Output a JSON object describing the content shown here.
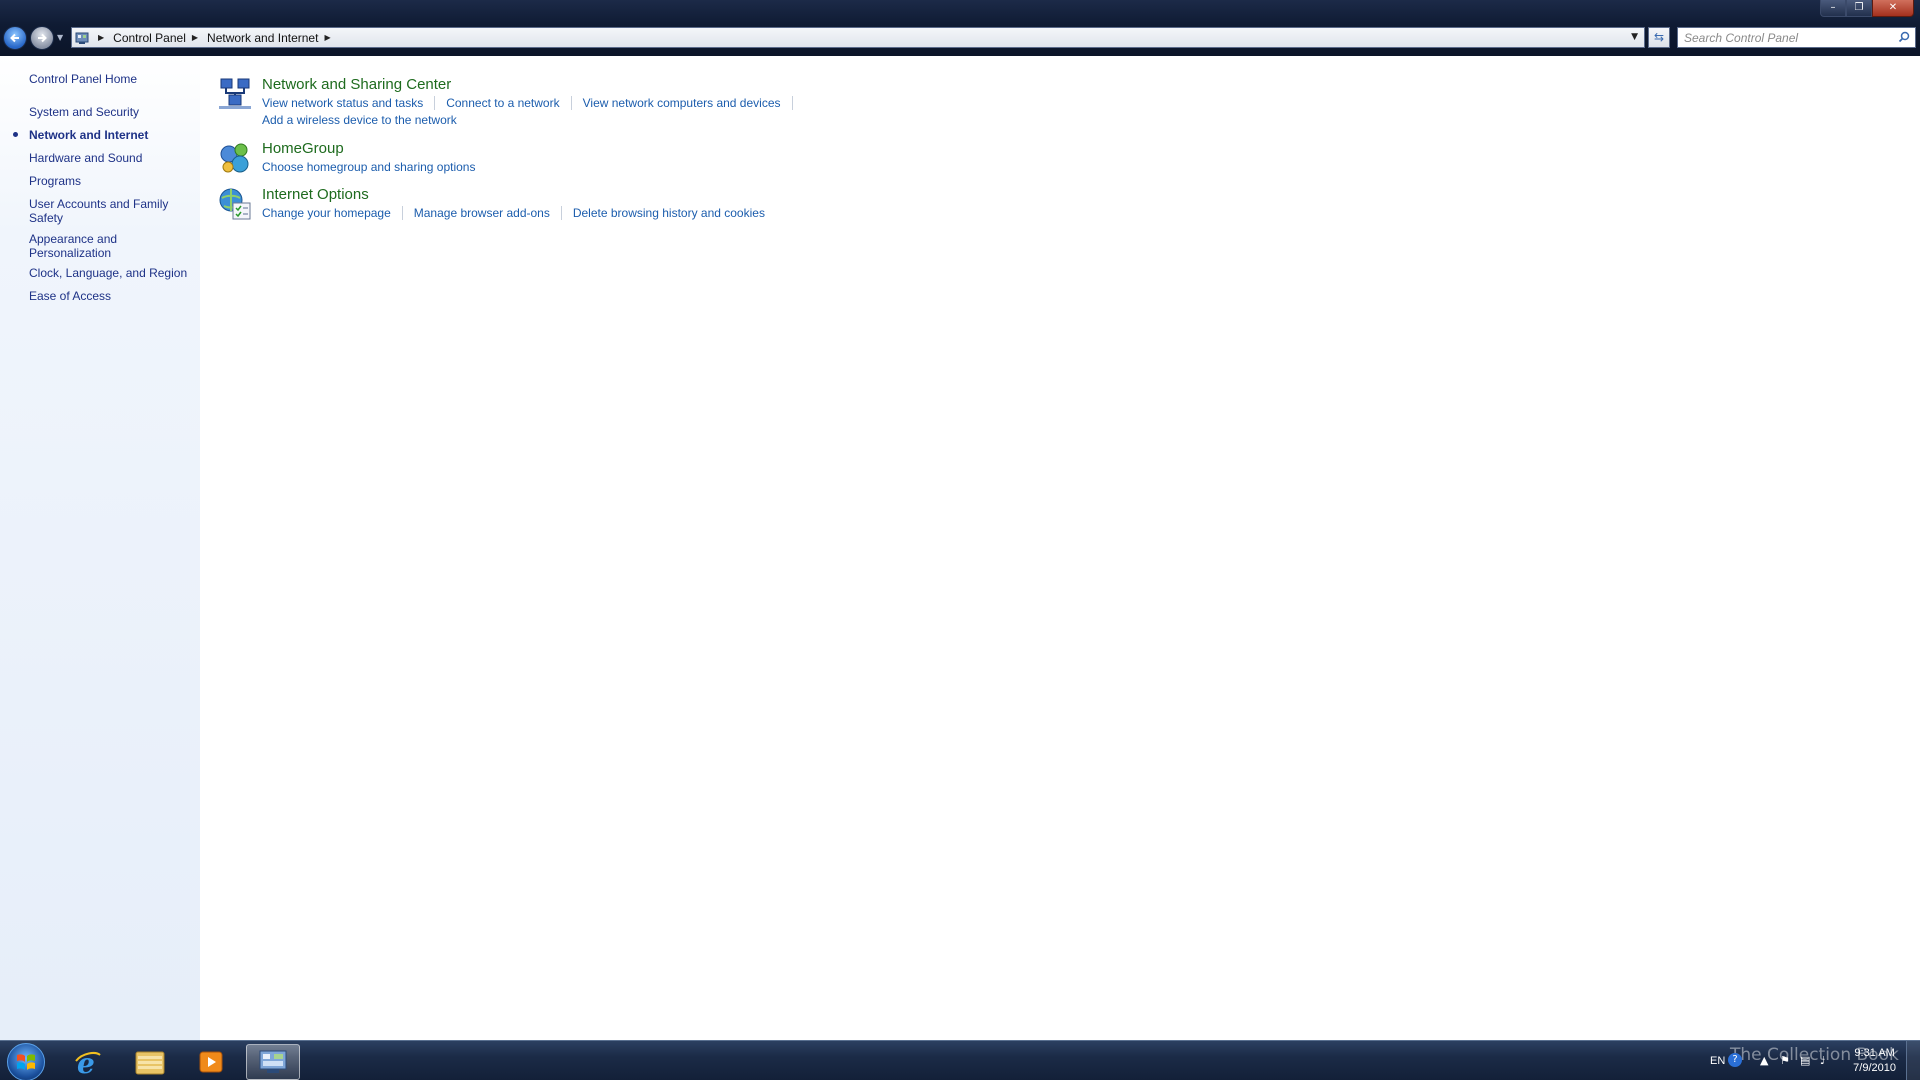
{
  "window": {
    "minimize_icon": "minimize-icon",
    "maximize_icon": "maximize-icon",
    "close_icon": "close-icon"
  },
  "address_bar": {
    "breadcrumbs": [
      "Control Panel",
      "Network and Internet"
    ],
    "search_placeholder": "Search Control Panel"
  },
  "sidebar": {
    "items": [
      {
        "label": "Control Panel Home"
      },
      {
        "label": "System and Security"
      },
      {
        "label": "Network and Internet",
        "active": true
      },
      {
        "label": "Hardware and Sound"
      },
      {
        "label": "Programs"
      },
      {
        "label": "User Accounts and Family Safety"
      },
      {
        "label": "Appearance and Personalization"
      },
      {
        "label": "Clock, Language, and Region"
      },
      {
        "label": "Ease of Access"
      }
    ]
  },
  "categories": [
    {
      "title": "Network and Sharing Center",
      "icon": "network-sharing-icon",
      "links": [
        "View network status and tasks",
        "Connect to a network",
        "View network computers and devices"
      ],
      "links2": [
        "Add a wireless device to the network"
      ]
    },
    {
      "title": "HomeGroup",
      "icon": "homegroup-icon",
      "links": [
        "Choose homegroup and sharing options"
      ]
    },
    {
      "title": "Internet Options",
      "icon": "internet-options-icon",
      "links": [
        "Change your homepage",
        "Manage browser add-ons",
        "Delete browsing history and cookies"
      ]
    }
  ],
  "taskbar": {
    "apps": [
      "internet-explorer-icon",
      "windows-explorer-icon",
      "media-player-icon",
      "control-panel-icon"
    ],
    "tray": {
      "language": "EN",
      "time": "9:31 AM",
      "date": "7/9/2010"
    },
    "watermark": "The Collection Book"
  },
  "colors": {
    "link": "#1c5dad",
    "category_title": "#1e6b1e",
    "sidebar_text": "#1e3287"
  }
}
